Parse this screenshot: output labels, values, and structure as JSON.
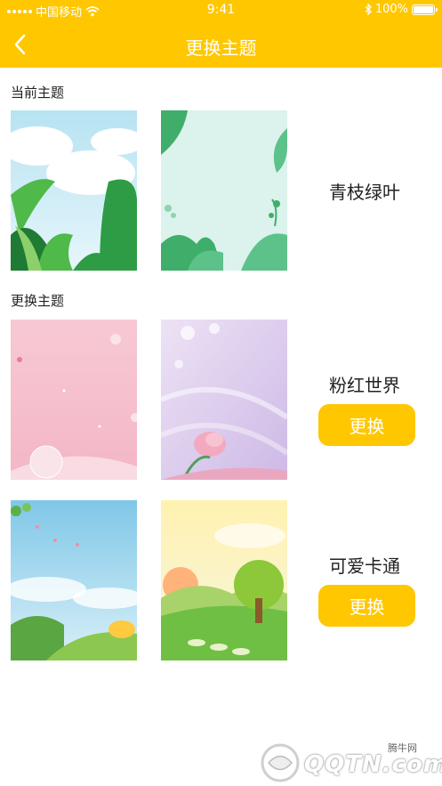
{
  "status_bar": {
    "carrier": "中国移动",
    "time": "9:41",
    "battery": "100%"
  },
  "nav": {
    "title": "更换主题"
  },
  "current_section": {
    "label": "当前主题",
    "theme_name": "青枝绿叶"
  },
  "change_section": {
    "label": "更换主题",
    "themes": [
      {
        "name": "粉红世界",
        "button_label": "更换"
      },
      {
        "name": "可爱卡通",
        "button_label": "更换"
      }
    ]
  },
  "watermark": {
    "text": "QQTN.com",
    "cn_text": "腾牛网"
  },
  "colors": {
    "accent": "#FFC700",
    "text": "#222222"
  }
}
